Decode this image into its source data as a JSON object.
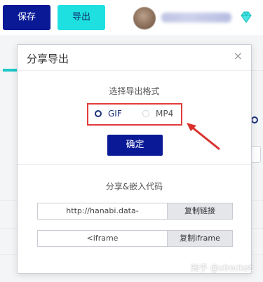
{
  "toolbar": {
    "save_label": "保存",
    "export_label": "导出",
    "diamond_icon": "diamond-icon",
    "accent_color": "#1fe0e0",
    "primary_color": "#0a1a96"
  },
  "dialog": {
    "title": "分享导出",
    "close_label": "×",
    "format_section_label": "选择导出格式",
    "formats": [
      {
        "label": "GIF",
        "selected": true
      },
      {
        "label": "MP4",
        "selected": false
      }
    ],
    "confirm_label": "确定",
    "embed_section_label": "分享&嵌入代码",
    "link_value": "http://hanabi.data-",
    "copy_link_label": "复制链接",
    "iframe_value": "<iframe",
    "copy_iframe_label": "复制iframe"
  },
  "annotation": {
    "highlight_color": "#e03c3c"
  },
  "watermark": "知乎 @xlrocket"
}
